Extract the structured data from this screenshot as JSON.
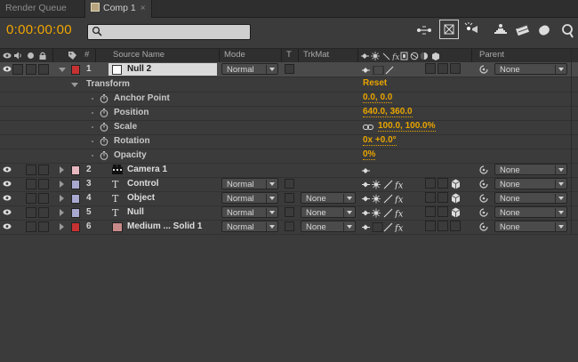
{
  "tabs": [
    {
      "label": "Render Queue",
      "active": false
    },
    {
      "label": "Comp 1",
      "active": true,
      "close": "×"
    }
  ],
  "toolbar": {
    "timecode": "0:00:00:00",
    "search_value": "",
    "icons": [
      "comp-flowchart-icon",
      "draft-3d-icon",
      "shy-layers-icon",
      "frame-blending-icon",
      "motion-blur-icon",
      "brainstorm-icon",
      "graph-editor-icon",
      "search-icon"
    ]
  },
  "columns": {
    "source_name": "Source Name",
    "mode": "Mode",
    "t": "T",
    "trkmat": "TrkMat",
    "parent": "Parent",
    "num": "#"
  },
  "layers": [
    {
      "num": "1",
      "name": "Null 2",
      "label_color": "#c63232",
      "source_icon": "null-swatch-icon",
      "mode": "Normal",
      "trkmat": "",
      "parent": "None",
      "expanded": true,
      "selected": true,
      "switch_icons": [
        "shy-icon",
        "",
        "quality-icon"
      ],
      "has_eye": true
    },
    {
      "num": "2",
      "name": "Camera 1",
      "label_color": "#e8b8c0",
      "source_icon": "camera-icon",
      "mode": "",
      "trkmat": "",
      "parent": "None",
      "expanded": false,
      "selected": false,
      "switch_icons": [
        "shy-icon"
      ],
      "has_eye": true
    },
    {
      "num": "3",
      "name": "Control",
      "label_color": "#a8a8d0",
      "source_icon": "text-icon",
      "mode": "Normal",
      "trkmat": "",
      "parent": "None",
      "expanded": false,
      "selected": false,
      "switch_icons": [
        "shy-icon",
        "collapse-icon",
        "quality-icon",
        "fx-icon",
        "",
        "",
        "3d-icon"
      ],
      "has_eye": true
    },
    {
      "num": "4",
      "name": "Object",
      "label_color": "#a8a8d0",
      "source_icon": "text-icon",
      "mode": "Normal",
      "trkmat": "None",
      "parent": "None",
      "expanded": false,
      "selected": false,
      "switch_icons": [
        "shy-icon",
        "collapse-icon",
        "quality-icon",
        "fx-icon",
        "",
        "",
        "3d-icon"
      ],
      "has_eye": true
    },
    {
      "num": "5",
      "name": "Null",
      "label_color": "#a8a8d0",
      "source_icon": "text-icon",
      "mode": "Normal",
      "trkmat": "None",
      "parent": "None",
      "expanded": false,
      "selected": false,
      "switch_icons": [
        "shy-icon",
        "collapse-icon",
        "quality-icon",
        "fx-icon",
        "",
        "",
        "3d-icon"
      ],
      "has_eye": true
    },
    {
      "num": "6",
      "name": "Medium ... Solid 1",
      "label_color": "#c63232",
      "source_icon": "solid-swatch-icon",
      "mode": "Normal",
      "trkmat": "None",
      "parent": "None",
      "expanded": false,
      "selected": false,
      "switch_icons": [
        "shy-icon",
        "",
        "quality-icon",
        "fx-icon",
        "",
        "",
        ""
      ],
      "has_eye": true
    }
  ],
  "transform": {
    "group_label": "Transform",
    "reset_label": "Reset",
    "properties": [
      {
        "name": "Anchor Point",
        "value": "0.0, 0.0"
      },
      {
        "name": "Position",
        "value": "640.0, 360.0"
      },
      {
        "name": "Scale",
        "value": "100.0, 100.0%",
        "linked": true
      },
      {
        "name": "Rotation",
        "value": "0x +0.0°"
      },
      {
        "name": "Opacity",
        "value": "0%"
      }
    ]
  },
  "colors": {
    "accent": "#e8a400",
    "timecode": "#f0a500",
    "panel": "#3b3b3b"
  }
}
